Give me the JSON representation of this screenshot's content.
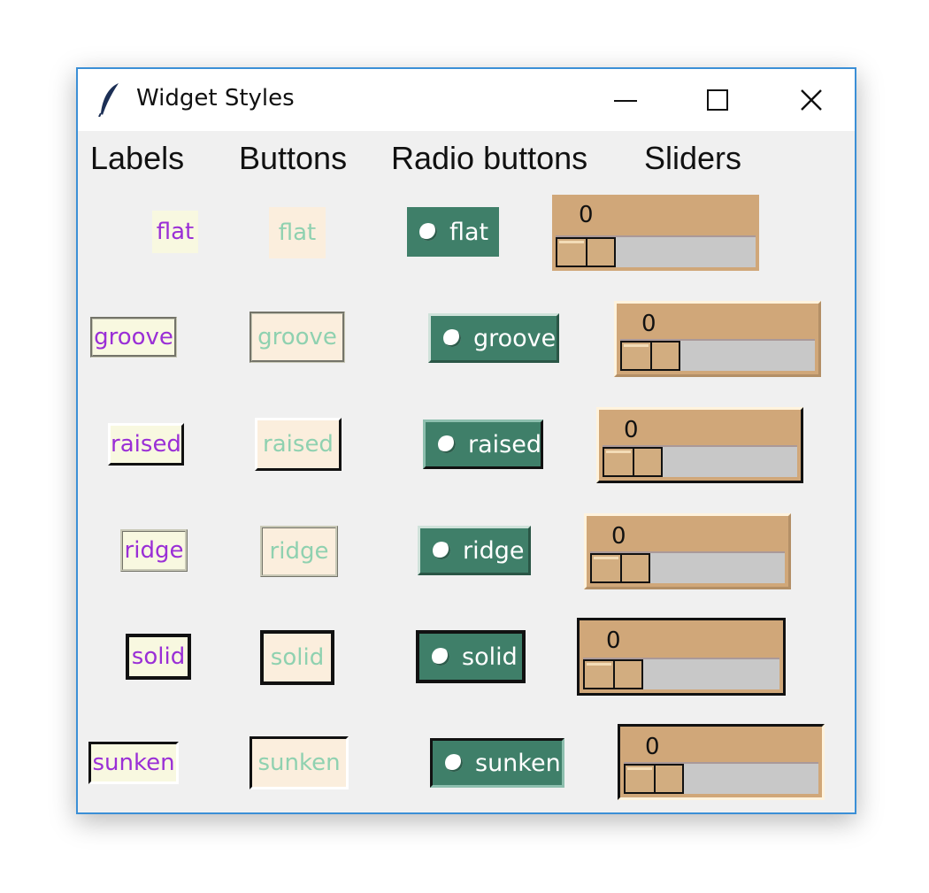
{
  "window": {
    "title": "Widget Styles",
    "icon": "feather-icon",
    "controls": [
      "minimize-icon",
      "maximize-icon",
      "close-icon"
    ]
  },
  "headers": {
    "labels": "Labels",
    "buttons": "Buttons",
    "radio_buttons": "Radio buttons",
    "sliders": "Sliders"
  },
  "rows": [
    {
      "relief": "flat",
      "label": "flat",
      "button": "flat",
      "radio": "flat",
      "slider_value": "0"
    },
    {
      "relief": "groove",
      "label": "groove",
      "button": "groove",
      "radio": "groove",
      "slider_value": "0"
    },
    {
      "relief": "raised",
      "label": "raised",
      "button": "raised",
      "radio": "raised",
      "slider_value": "0"
    },
    {
      "relief": "ridge",
      "label": "ridge",
      "button": "ridge",
      "radio": "ridge",
      "slider_value": "0"
    },
    {
      "relief": "solid",
      "label": "solid",
      "button": "solid",
      "radio": "solid",
      "slider_value": "0"
    },
    {
      "relief": "sunken",
      "label": "sunken",
      "button": "sunken",
      "radio": "sunken",
      "slider_value": "0"
    }
  ],
  "colors": {
    "label_bg": "#f8f8e0",
    "label_fg": "#9a2fd6",
    "button_bg": "#fbeedd",
    "button_fg": "#8fd1b0",
    "radio_bg": "#3f7f69",
    "radio_fg": "#ffffff",
    "slider_bg": "#d0a779",
    "slider_trough": "#c8c8c8",
    "window_border": "#3b8fd6"
  }
}
